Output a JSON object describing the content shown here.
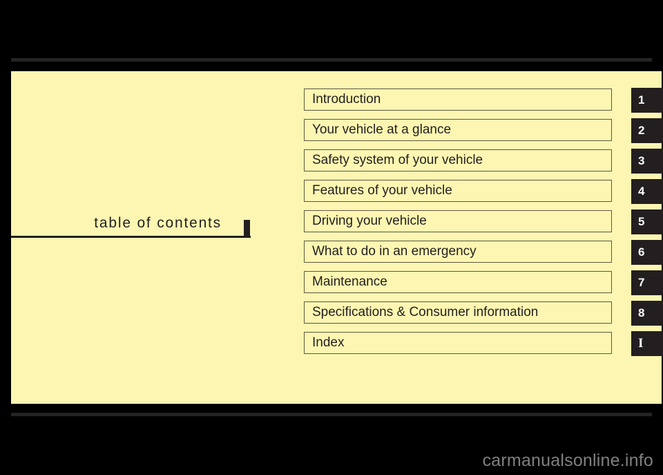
{
  "page": {
    "title_text": "table of contents",
    "background_color": "#fcf6b2",
    "ink_color": "#231f20"
  },
  "contents": {
    "entries": [
      {
        "label": "Introduction",
        "tab": "1"
      },
      {
        "label": "Your vehicle at a glance",
        "tab": "2"
      },
      {
        "label": "Safety system of your vehicle",
        "tab": "3"
      },
      {
        "label": "Features of your vehicle",
        "tab": "4"
      },
      {
        "label": "Driving your vehicle",
        "tab": "5"
      },
      {
        "label": "What to do in an emergency",
        "tab": "6"
      },
      {
        "label": "Maintenance",
        "tab": "7"
      },
      {
        "label": "Specifications & Consumer information",
        "tab": "8"
      },
      {
        "label": "Index",
        "tab": "I"
      }
    ]
  },
  "watermark": {
    "text": "carmanualsonline.info",
    "color": "#808080"
  }
}
